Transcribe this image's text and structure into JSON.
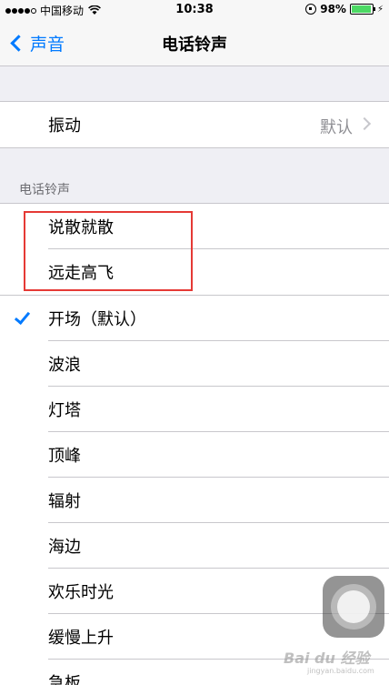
{
  "status_bar": {
    "carrier": "中国移动",
    "time": "10:38",
    "battery": "98%",
    "battery_level": 0.98
  },
  "nav": {
    "back_label": "声音",
    "title": "电话铃声"
  },
  "vibration": {
    "label": "振动",
    "value": "默认"
  },
  "section_header": "电话铃声",
  "custom_ringtones": [
    {
      "label": "说散就散"
    },
    {
      "label": "远走高飞"
    }
  ],
  "ringtones": [
    {
      "label": "开场（默认）",
      "selected": true
    },
    {
      "label": "波浪",
      "selected": false
    },
    {
      "label": "灯塔",
      "selected": false
    },
    {
      "label": "顶峰",
      "selected": false
    },
    {
      "label": "辐射",
      "selected": false
    },
    {
      "label": "海边",
      "selected": false
    },
    {
      "label": "欢乐时光",
      "selected": false
    },
    {
      "label": "缓慢上升",
      "selected": false
    },
    {
      "label": "急板",
      "selected": false
    }
  ],
  "watermark": {
    "text": "Bai du 经验",
    "sub": "jingyan.baidu.com"
  },
  "colors": {
    "accent": "#007aff",
    "highlight": "#e53935",
    "background": "#efeff4"
  }
}
